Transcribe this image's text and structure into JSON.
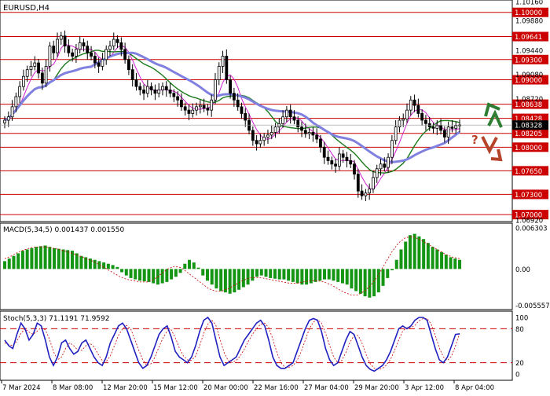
{
  "symbol_label": "EURUSD,H4",
  "colors": {
    "candle": "#000000",
    "ma_fast": "#d020d0",
    "ma_mid": "#1a7a1a",
    "ma_slow": "#8080e0",
    "level_line": "#cc0000",
    "level_label_bg": "#cc0000",
    "current_label_bg": "#000000",
    "macd_hist": "#149614",
    "macd_signal": "#cc0000",
    "stoch_main": "#2020c0",
    "stoch_signal": "#cc0000",
    "arrow_up": "#2e7d32",
    "arrow_down": "#b5442a",
    "question_mark": "#b5442a"
  },
  "chart_data": [
    {
      "type": "candlestick",
      "title": "EURUSD,H4",
      "y_axis_ticks": [
        "1.10160",
        "1.09880",
        "1.09440",
        "1.09080",
        "1.08720",
        "1.06920"
      ],
      "ylim": [
        1.0692,
        1.1016
      ],
      "levels": [
        1.1,
        1.09641,
        1.093,
        1.09,
        1.08638,
        1.08428,
        1.08205,
        1.08,
        1.0765,
        1.073,
        1.07
      ],
      "level_labels": [
        "1.10000",
        "1.09641",
        "1.09300",
        "1.09000",
        "1.08638",
        "1.08428",
        "1.08205",
        "1.08000",
        "1.07650",
        "1.07300",
        "1.07000"
      ],
      "current_price": 1.08328,
      "current_price_label": "1.08328",
      "x_tick_labels": [
        "7 Mar 2024",
        "8 Mar 08:00",
        "12 Mar 20:00",
        "15 Mar 12:00",
        "20 Mar 00:00",
        "22 Mar 16:00",
        "27 Mar 04:00",
        "29 Mar 20:00",
        "3 Apr 12:00",
        "8 Apr 04:00"
      ],
      "closes": [
        1.084,
        1.0845,
        1.086,
        1.0875,
        1.089,
        1.0905,
        1.0915,
        1.092,
        1.0925,
        1.091,
        1.0895,
        1.092,
        1.095,
        1.094,
        1.096,
        1.0965,
        1.095,
        1.094,
        1.0935,
        1.0945,
        1.0955,
        1.095,
        1.094,
        1.0935,
        1.0925,
        1.092,
        1.093,
        1.0945,
        1.095,
        1.096,
        1.0955,
        1.0945,
        1.093,
        1.0915,
        1.09,
        1.089,
        1.0885,
        1.088,
        1.089,
        1.0885,
        1.088,
        1.0885,
        1.089,
        1.0885,
        1.088,
        1.0875,
        1.087,
        1.086,
        1.0855,
        1.085,
        1.0855,
        1.086,
        1.0862,
        1.0858,
        1.0855,
        1.087,
        1.09,
        1.092,
        1.0935,
        1.09,
        1.088,
        1.087,
        1.086,
        1.085,
        1.084,
        1.0825,
        1.081,
        1.0805,
        1.081,
        1.0815,
        1.0818,
        1.0822,
        1.083,
        1.0835,
        1.0845,
        1.0855,
        1.0845,
        1.084,
        1.083,
        1.0825,
        1.082,
        1.0822,
        1.0818,
        1.0812,
        1.08,
        1.0785,
        1.078,
        1.0775,
        1.0772,
        1.079,
        1.0785,
        1.078,
        1.0775,
        1.076,
        1.0735,
        1.0728,
        1.0732,
        1.0738,
        1.0755,
        1.0768,
        1.0775,
        1.077,
        1.0785,
        1.081,
        1.083,
        1.084,
        1.0842,
        1.0855,
        1.087,
        1.0862,
        1.085,
        1.084,
        1.0835,
        1.083,
        1.0828,
        1.0832,
        1.0825,
        1.0815,
        1.083,
        1.0828,
        1.0832,
        1.0833
      ]
    },
    {
      "type": "bar",
      "title": "MACD(5,34,5) 0.001437 0.001550",
      "y_axis_ticks": [
        "0.006303",
        "0.00",
        "-0.005557"
      ],
      "ylim": [
        -0.006,
        0.0068
      ],
      "series": [
        {
          "values": [
            0.0012,
            0.0016,
            0.002,
            0.0024,
            0.0028,
            0.003,
            0.0032,
            0.0034,
            0.0035,
            0.0036,
            0.0034,
            0.0032,
            0.0031,
            0.003,
            0.0029,
            0.0028,
            0.0024,
            0.002,
            0.0018,
            0.0016,
            0.0014,
            0.0012,
            0.001,
            0.0008,
            0.0006,
            0.0003,
            -0.0005,
            -0.001,
            -0.0014,
            -0.0016,
            -0.0018,
            -0.0019,
            -0.002,
            -0.0022,
            -0.0024,
            -0.0022,
            -0.002,
            -0.0016,
            -0.0012,
            -0.0006,
            0.0008,
            0.0014,
            0.001,
            0.0002,
            -0.001,
            -0.0018,
            -0.0024,
            -0.003,
            -0.0034,
            -0.0036,
            -0.0038,
            -0.0036,
            -0.0032,
            -0.0028,
            -0.0024,
            -0.0018,
            -0.0012,
            -0.001,
            -0.0012,
            -0.0014,
            -0.0015,
            -0.0016,
            -0.0016,
            -0.0018,
            -0.002,
            -0.0022,
            -0.0024,
            -0.0024,
            -0.0022,
            -0.002,
            -0.0018,
            -0.0016,
            -0.0016,
            -0.0018,
            -0.002,
            -0.0022,
            -0.0024,
            -0.003,
            -0.0034,
            -0.0038,
            -0.0042,
            -0.0044,
            -0.0042,
            -0.0036,
            -0.0026,
            -0.0014,
            -0.0002,
            0.0014,
            0.003,
            0.0042,
            0.0052,
            0.0054,
            0.005,
            0.0046,
            0.004,
            0.0034,
            0.003,
            0.0026,
            0.0022,
            0.0018,
            0.0016,
            0.0014
          ]
        },
        {
          "values": [
            0.0016,
            0.002,
            0.0026,
            0.003,
            0.0033,
            0.0034,
            0.0034,
            0.0032,
            0.003,
            0.0027,
            0.0024,
            0.002,
            0.0016,
            0.0012,
            0.0006,
            0.0,
            -0.0006,
            -0.0012,
            -0.0016,
            -0.0018,
            -0.002,
            -0.002,
            -0.0016,
            -0.0008,
            0.0,
            0.0004,
            0.0002,
            -0.0006,
            -0.0014,
            -0.0022,
            -0.003,
            -0.0034,
            -0.0034,
            -0.003,
            -0.0024,
            -0.0018,
            -0.0014,
            -0.0013,
            -0.0014,
            -0.0016,
            -0.0018,
            -0.002,
            -0.0022,
            -0.0022,
            -0.002,
            -0.0018,
            -0.0018,
            -0.002,
            -0.0024,
            -0.003,
            -0.0036,
            -0.004,
            -0.004,
            -0.0034,
            -0.0024,
            -0.001,
            0.0008,
            0.0026,
            0.004,
            0.0048,
            0.005,
            0.0046,
            0.004,
            0.0034,
            0.0028,
            0.0022,
            0.0018,
            0.0016
          ]
        }
      ]
    },
    {
      "type": "line",
      "title": "Stoch(5,3,3) 71.1191 71.9592",
      "y_axis_ticks": [
        "100",
        "80",
        "20",
        "0"
      ],
      "ylim": [
        0,
        100
      ],
      "levels": [
        80,
        20
      ],
      "series": [
        {
          "values": [
            60,
            50,
            45,
            70,
            90,
            80,
            60,
            70,
            90,
            85,
            60,
            30,
            15,
            30,
            55,
            60,
            45,
            35,
            40,
            55,
            60,
            45,
            30,
            20,
            15,
            30,
            55,
            70,
            85,
            90,
            80,
            60,
            40,
            20,
            10,
            15,
            30,
            50,
            70,
            80,
            85,
            65,
            40,
            30,
            25,
            20,
            30,
            50,
            75,
            95,
            100,
            90,
            60,
            30,
            15,
            20,
            25,
            30,
            45,
            60,
            70,
            80,
            90,
            95,
            85,
            60,
            30,
            15,
            10,
            10,
            15,
            20,
            40,
            60,
            80,
            95,
            98,
            95,
            75,
            45,
            25,
            15,
            20,
            40,
            60,
            75,
            70,
            50,
            30,
            15,
            8,
            5,
            10,
            15,
            25,
            40,
            60,
            80,
            85,
            80,
            85,
            95,
            100,
            100,
            95,
            70,
            45,
            25,
            20,
            30,
            50,
            70,
            71
          ]
        },
        {
          "values": [
            55,
            52,
            50,
            58,
            72,
            80,
            74,
            70,
            76,
            82,
            78,
            62,
            40,
            25,
            30,
            45,
            55,
            50,
            42,
            42,
            50,
            54,
            48,
            35,
            24,
            22,
            32,
            50,
            68,
            80,
            86,
            80,
            62,
            42,
            25,
            15,
            18,
            30,
            48,
            64,
            76,
            78,
            64,
            46,
            32,
            25,
            24,
            32,
            50,
            72,
            88,
            95,
            86,
            62,
            38,
            24,
            20,
            24,
            32,
            44,
            58,
            70,
            80,
            88,
            90,
            82,
            62,
            38,
            20,
            12,
            12,
            15,
            24,
            40,
            60,
            80,
            92,
            96,
            90,
            72,
            50,
            30,
            20,
            24,
            38,
            56,
            68,
            68,
            54,
            34,
            18,
            10,
            8,
            10,
            16,
            26,
            42,
            60,
            76,
            82,
            82,
            86,
            94,
            98,
            98,
            88,
            68,
            46,
            30,
            24,
            32,
            50,
            72
          ]
        }
      ]
    }
  ]
}
